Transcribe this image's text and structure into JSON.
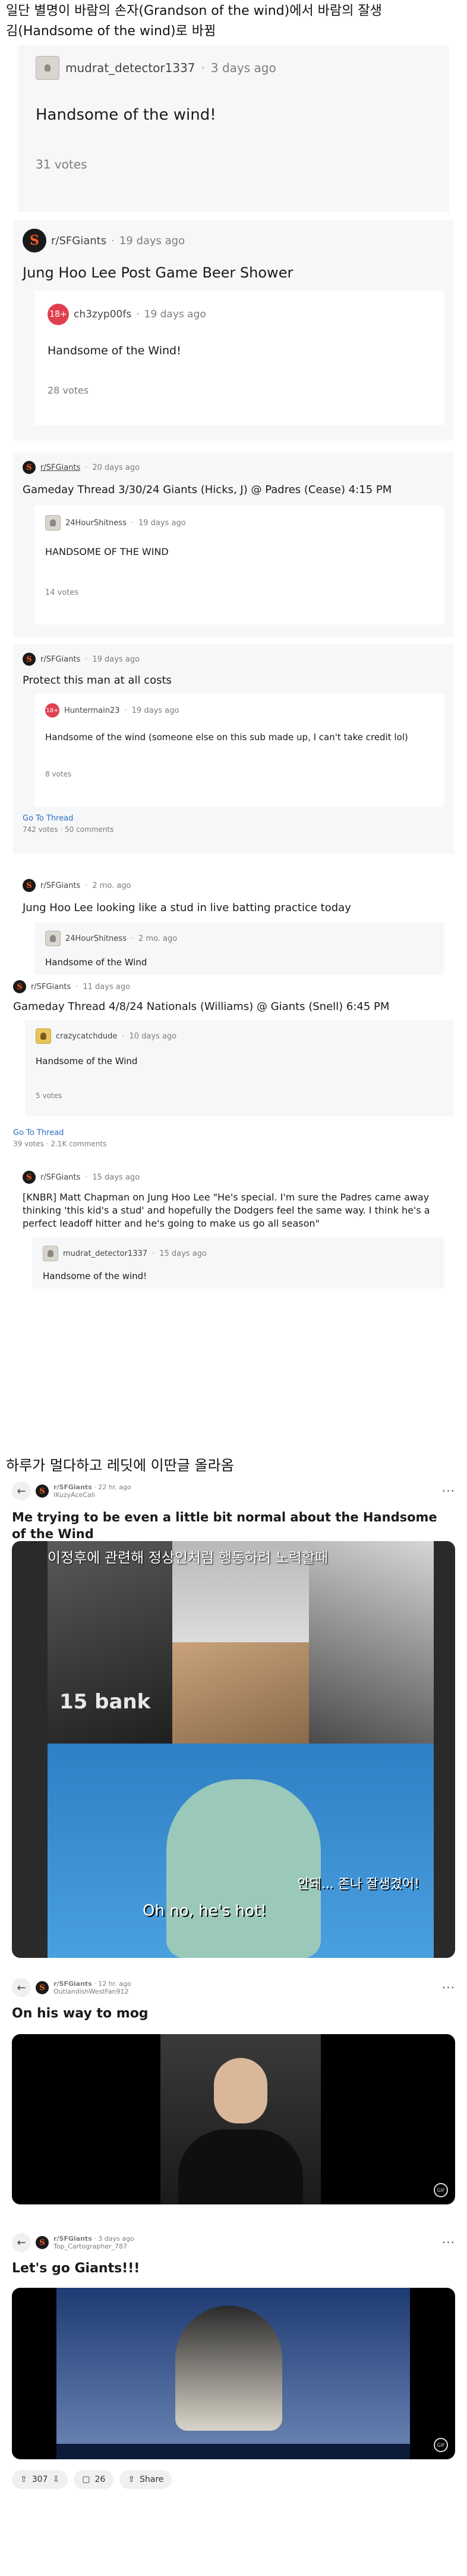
{
  "intro": {
    "line1": "일단 별명이 바람의 손자(Grandson of the wind)에서 바람의 잘생",
    "line2": "김(Handsome of the wind)로 바뀜"
  },
  "thread1": {
    "username": "mudrat_detector1337",
    "time": "3 days ago",
    "body": "Handsome of the wind!",
    "votes": "31 votes"
  },
  "thread2": {
    "subreddit": "r/SFGiants",
    "time": "19 days ago",
    "title": "Jung Hoo Lee Post Game Beer Shower",
    "reply": {
      "avatar": "18+",
      "username": "ch3zyp00fs",
      "time": "19 days ago",
      "body": "Handsome of the Wind!",
      "votes": "28 votes"
    }
  },
  "thread3": {
    "subreddit": "r/SFGiants",
    "time": "20 days ago",
    "title": "Gameday Thread 3/30/24 Giants (Hicks, J) @ Padres (Cease) 4:15 PM",
    "reply": {
      "username": "24HourShitness",
      "time": "19 days ago",
      "body": "HANDSOME OF THE WIND",
      "votes": "14 votes"
    }
  },
  "thread4": {
    "subreddit": "r/SFGiants",
    "time": "19 days ago",
    "title": "Protect this man at all costs",
    "reply": {
      "avatar": "18+",
      "username": "Huntermain23",
      "time": "19 days ago",
      "body": "Handsome of the wind (someone else on this sub made up, I can't take credit lol)",
      "votes": "8 votes"
    },
    "goto": "Go To Thread",
    "votes": "742 votes",
    "comments": "50 comments"
  },
  "thread5": {
    "subreddit": "r/SFGiants",
    "time": "2 mo. ago",
    "title": "Jung Hoo Lee looking like a stud in live batting practice today",
    "reply": {
      "username": "24HourShitness",
      "time": "2 mo. ago",
      "body": "Handsome of the Wind"
    }
  },
  "thread6": {
    "subreddit": "r/SFGiants",
    "time": "11 days ago",
    "title": "Gameday Thread 4/8/24 Nationals (Williams) @ Giants (Snell) 6:45 PM",
    "reply": {
      "username": "crazycatchdude",
      "time": "10 days ago",
      "body": "Handsome of the Wind",
      "votes": "5 votes"
    },
    "goto": "Go To Thread",
    "votes": "39 votes",
    "comments": "2.1K comments"
  },
  "thread7": {
    "subreddit": "r/SFGiants",
    "time": "15 days ago",
    "title": "[KNBR] Matt Chapman on Jung Hoo Lee \"He's special. I'm sure the Padres came away thinking 'this kid's a stud' and hopefully the Dodgers feel the same way. I think he's a perfect leadoff hitter and he's going to make us go all season\"",
    "reply": {
      "username": "mudrat_detector1337",
      "time": "15 days ago",
      "body": "Handsome of the wind!"
    }
  },
  "section2_heading": "하루가 멀다하고 레딧에 이딴글 올라옴",
  "post1": {
    "subreddit": "r/SFGiants",
    "time": "22 hr. ago",
    "user": "IKuzyAceCali",
    "title": "Me trying to be even a little bit normal about the Handsome of the Wind",
    "caption_top": "이정후에 관련해 정상인처럼 행동하려 노력할때",
    "caption_kr": "안돼... 존나 잘생겼어!",
    "caption_bottom": "Oh no, he's hot!"
  },
  "post2": {
    "subreddit": "r/SFGiants",
    "time": "12 hr. ago",
    "user": "OutlandishWestFan912",
    "title": "On his way to mog",
    "gif": "GIF"
  },
  "post3": {
    "subreddit": "r/SFGiants",
    "time": "3 days ago",
    "user": "Top_Cartographer_787",
    "title": "Let's go Giants!!!",
    "gif": "GIF",
    "upvotes": "307",
    "comments": "26",
    "share": "Share"
  },
  "colors": {
    "giants_orange": "#fd5a1e",
    "nsfw_red": "#e0404e",
    "link_blue": "#2c6cc4"
  }
}
